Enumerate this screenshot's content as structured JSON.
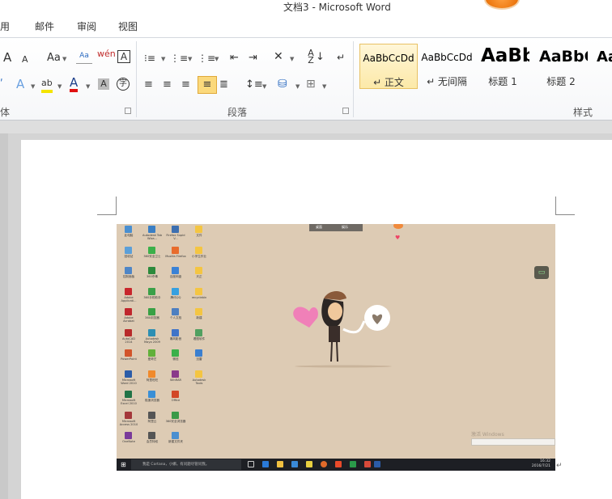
{
  "window": {
    "title": "文档3  -  Microsoft Word"
  },
  "tabs": [
    "用",
    "邮件",
    "审阅",
    "视图"
  ],
  "ribbon": {
    "font_group_label": "体",
    "paragraph_group_label": "段落",
    "styles_group_label": "样式",
    "font_buttons": {
      "grow": "A",
      "shrink": "A",
      "case": "Aa",
      "phonetic": "wén",
      "border_char": "A",
      "text_effect": "A",
      "highlight": "ab",
      "font_color": "A",
      "shade_char": "A",
      "enclose": "字"
    },
    "styles": [
      {
        "sample": "AaBbCcDd",
        "name": "↵ 正文",
        "selected": true
      },
      {
        "sample": "AaBbCcDd",
        "name": "↵ 无间隔",
        "selected": false
      },
      {
        "sample": "AaBb",
        "name": "标题 1",
        "selected": false
      },
      {
        "sample": "AaBbC",
        "name": "标题 2",
        "selected": false
      },
      {
        "sample": "Aa",
        "name": "",
        "selected": false
      }
    ]
  },
  "document": {
    "screenshot": {
      "top_tabs": [
        "桌面",
        "娱乐"
      ],
      "activation_text": [
        "激活 Windows",
        "转到\"设置\"以激活 Windows。"
      ],
      "taskbar": {
        "search_placeholder": "我是 Cortana，小娜。有问题尽管问我。",
        "time": "16:32",
        "date": "2016/7/21"
      },
      "desktop_icons": [
        {
          "label": "此电脑",
          "color": "#4a8fd0"
        },
        {
          "label": "Autodesk Tab Wiza...",
          "color": "#3b7fc4"
        },
        {
          "label": "Firefox Supid V...",
          "color": "#3d6fb0"
        },
        {
          "label": "文件",
          "color": "#f4c542"
        },
        {
          "label": "回收站",
          "color": "#5c9fd8"
        },
        {
          "label": "360安全卫士",
          "color": "#3cb04a"
        },
        {
          "label": "Mozilla Firefox",
          "color": "#e86c2c"
        },
        {
          "label": "小学生作业",
          "color": "#f4c542"
        },
        {
          "label": "控制面板",
          "color": "#4f86c6"
        },
        {
          "label": "360杀毒",
          "color": "#2c8a3c"
        },
        {
          "label": "百度网盘",
          "color": "#3a82d6"
        },
        {
          "label": "天正",
          "color": "#f4c542"
        },
        {
          "label": "Adobe Applicati...",
          "color": "#c8262c"
        },
        {
          "label": "360手机助手",
          "color": "#3aa048"
        },
        {
          "label": "腾讯QQ",
          "color": "#36a0e0"
        },
        {
          "label": "recyclebin",
          "color": "#f4c542"
        },
        {
          "label": "Adobe Acrobat",
          "color": "#c0262c"
        },
        {
          "label": "360浏览器",
          "color": "#39a145"
        },
        {
          "label": "个人文档",
          "color": "#4d7fc0"
        },
        {
          "label": "新建",
          "color": "#f4c542"
        },
        {
          "label": "AutoCAD 2014",
          "color": "#b82a2a"
        },
        {
          "label": "Autodesk Maya 2009",
          "color": "#2d8fb3"
        },
        {
          "label": "暴风影音",
          "color": "#4074c8"
        },
        {
          "label": "看图软件",
          "color": "#50a060"
        },
        {
          "label": "PowerPoint",
          "color": "#d2542a"
        },
        {
          "label": "爱奇艺",
          "color": "#62b03a"
        },
        {
          "label": "微信",
          "color": "#3ab04a"
        },
        {
          "label": "迅雷",
          "color": "#3a7fd0"
        },
        {
          "label": "Microsoft Word 2010",
          "color": "#2b5ca8"
        },
        {
          "label": "阿里旺旺",
          "color": "#f08a2c"
        },
        {
          "label": "WinRAR",
          "color": "#8a3a8a"
        },
        {
          "label": "Autodesk Tools",
          "color": "#f4c542"
        },
        {
          "label": "Microsoft Excel 2010",
          "color": "#217346"
        },
        {
          "label": "极速浏览器",
          "color": "#3a8fd6"
        },
        {
          "label": "Office",
          "color": "#d24726"
        },
        {
          "label": "",
          "color": "#ddcbb4"
        },
        {
          "label": "Microsoft Access 2010",
          "color": "#a4373a"
        },
        {
          "label": "阿里云",
          "color": "#555555"
        },
        {
          "label": "360安全浏览器",
          "color": "#3a9a48"
        },
        {
          "label": "",
          "color": "#ddcbb4"
        },
        {
          "label": "OneNote",
          "color": "#7a3a9a"
        },
        {
          "label": "会员特权",
          "color": "#555555"
        },
        {
          "label": "新建文件夹",
          "color": "#4a8fd0"
        },
        {
          "label": "",
          "color": "#ddcbb4"
        }
      ]
    }
  }
}
